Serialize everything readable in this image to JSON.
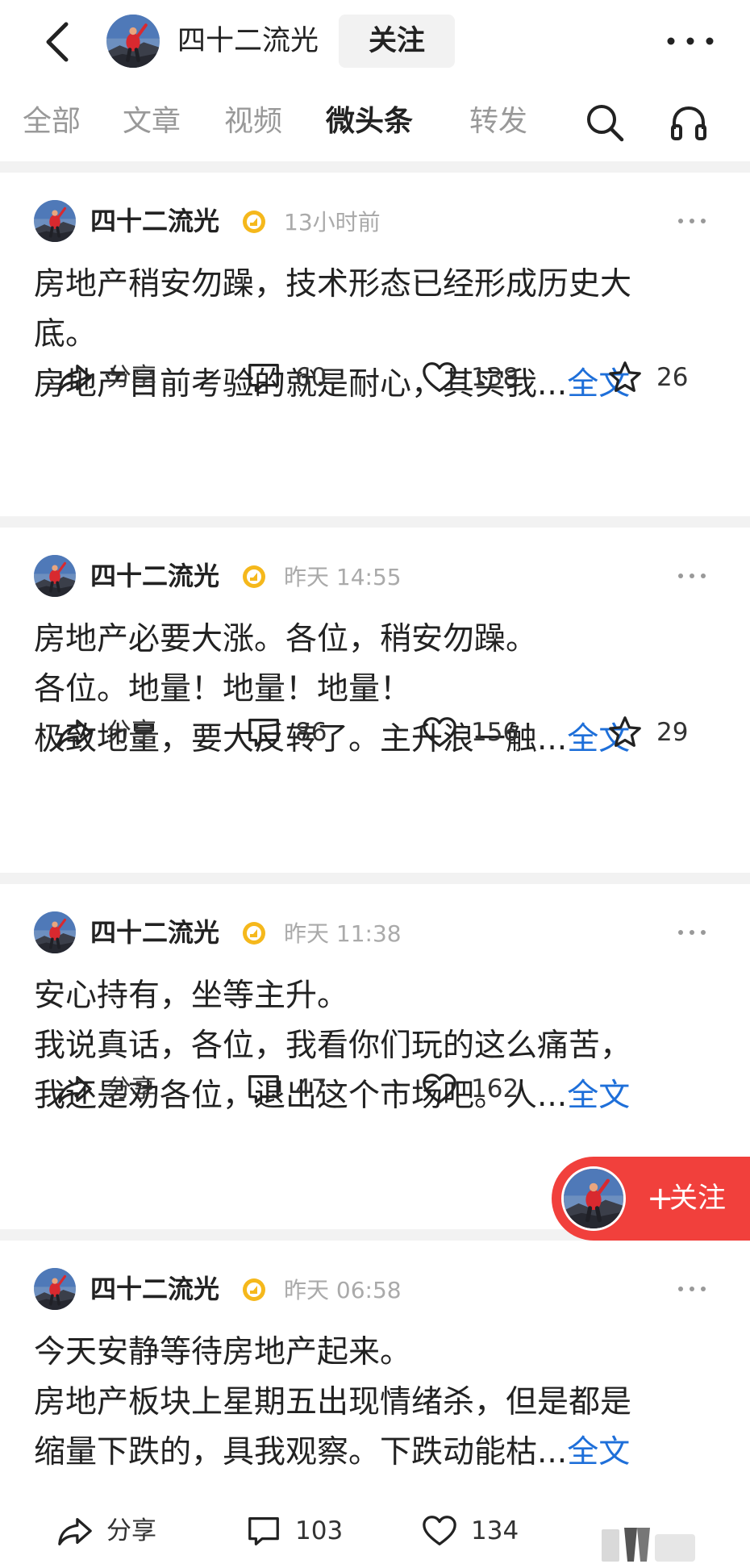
{
  "header": {
    "author_name": "四十二流光",
    "follow_label": "关注"
  },
  "tabs": [
    {
      "label": "全部",
      "active": false
    },
    {
      "label": "文章",
      "active": false
    },
    {
      "label": "视频",
      "active": false
    },
    {
      "label": "微头条",
      "active": true
    },
    {
      "label": "转发",
      "active": false
    }
  ],
  "posts": [
    {
      "author": "四十二流光",
      "time": "13小时前",
      "lines": [
        "房地产稍安勿躁，技术形态已经形成历史大",
        "底。",
        "房地产目前考验的就是耐心，其实我"
      ],
      "ellipsis": "...",
      "full_label": "全文",
      "share_label": "分享",
      "comments": "60",
      "likes": "138",
      "favorites": "26"
    },
    {
      "author": "四十二流光",
      "time": "昨天  14:55",
      "lines": [
        "房地产必要大涨。各位，稍安勿躁。",
        "各位。地量！地量！地量！",
        "极致地量，要大反转了。主升浪一触"
      ],
      "ellipsis": "...",
      "full_label": "全文",
      "share_label": "分享",
      "comments": "86",
      "likes": "156",
      "favorites": "29"
    },
    {
      "author": "四十二流光",
      "time": "昨天  11:38",
      "lines": [
        "安心持有，坐等主升。",
        "我说真话，各位，我看你们玩的这么痛苦，",
        "我还是劝各位，退出这个市场吧。人"
      ],
      "ellipsis": "...",
      "full_label": "全文",
      "share_label": "分享",
      "comments": "47",
      "likes": "162"
    },
    {
      "author": "四十二流光",
      "time": "昨天  06:58",
      "lines": [
        "今天安静等待房地产起来。",
        "房地产板块上星期五出现情绪杀，但是都是",
        "缩量下跌的，具我观察。下跌动能枯"
      ],
      "ellipsis": "...",
      "full_label": "全文",
      "share_label": "分享",
      "comments": "103",
      "likes": "134"
    }
  ],
  "floating_follow": {
    "label": "关注"
  },
  "colors": {
    "link": "#1e6fd9",
    "follow_red": "#f1403c",
    "verified_gold": "#f5b81c",
    "divider": "#f2f2f2"
  }
}
